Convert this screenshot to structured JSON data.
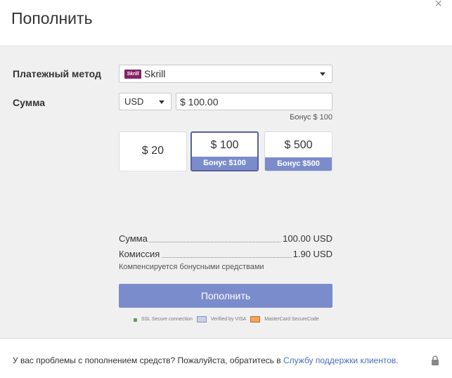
{
  "header": {
    "title": "Пополнить",
    "close_glyph": "×"
  },
  "form": {
    "payment_method_label": "Платежный метод",
    "payment_method": {
      "logo_text": "Skrill",
      "value": "Skrill",
      "logo_color": "#862165"
    },
    "amount_label": "Сумма",
    "currency": "USD",
    "amount_value": "$ 100.00",
    "bonus_note": "Бонус $ 100"
  },
  "presets": [
    {
      "amount": "$ 20",
      "bonus": "",
      "selected": false
    },
    {
      "amount": "$ 100",
      "bonus": "Бонус $100",
      "selected": true
    },
    {
      "amount": "$ 500",
      "bonus": "Бонус $500",
      "selected": false
    }
  ],
  "summary": {
    "sum_label": "Сумма",
    "sum_value": "100.00 USD",
    "fee_label": "Комиссия",
    "fee_value": "1.90 USD",
    "compensation_note": "Компенсируется бонусными средствами"
  },
  "submit_label": "Пополнить",
  "badges": {
    "ssl": "SSL Secure connection",
    "visa": "Verified by VISA",
    "mastercard": "MasterCard SecureCode"
  },
  "footer": {
    "text": "У вас проблемы с пополнением средств? Пожалуйста, обратитесь в ",
    "link": "Службу поддержки клиентов",
    "suffix": "."
  },
  "colors": {
    "accent": "#7b8ccc",
    "accent_dark": "#56629a",
    "link": "#4a6ebf"
  }
}
